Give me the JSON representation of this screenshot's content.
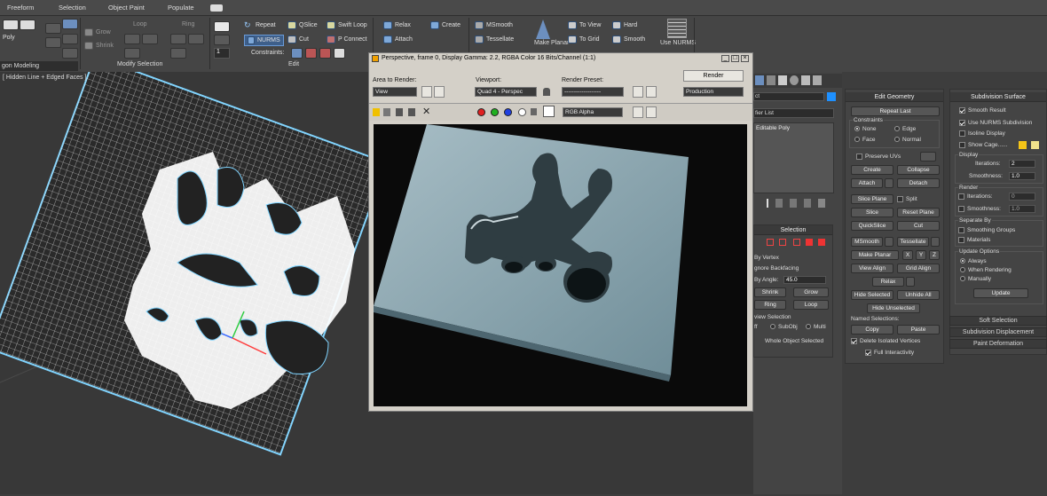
{
  "tabs": [
    "Freeform",
    "Selection",
    "Object Paint",
    "Populate"
  ],
  "ribbon": {
    "polygon_modeling": {
      "poly_label": "Poly",
      "panel_label": "gon Modeling"
    },
    "modify_selection": {
      "grow": "Grow",
      "shrink": "Shrink",
      "loop": "Loop",
      "ring": "Ring",
      "label": "Modify Selection"
    },
    "edit": {
      "repeat": "Repeat",
      "qslice": "QSlice",
      "swift_loop": "Swift Loop",
      "nurms": "NURMS",
      "cut": "Cut",
      "p_connect": "P Connect",
      "constraints": "Constraints:",
      "label": "Edit",
      "spinner_value": "1"
    },
    "geometry": {
      "relax": "Relax",
      "create": "Create",
      "attach": "Attach"
    },
    "subdivision": {
      "msmooth": "MSmooth",
      "tessellate": "Tessellate",
      "make_planar": "Make Planar",
      "to_view": "To View",
      "to_grid": "To Grid",
      "hard": "Hard",
      "smooth": "Smooth",
      "use_nurms": "Use NURMS"
    }
  },
  "viewport": {
    "label": "[ Hidden Line + Edged Faces ]"
  },
  "render_window": {
    "title": "Perspective, frame 0, Display Gamma: 2.2, RGBA Color 16 Bits/Channel (1:1)",
    "area_to_render_label": "Area to Render:",
    "area_to_render_value": "View",
    "viewport_label": "Viewport:",
    "viewport_value": "Quad 4 - Perspec",
    "render_preset_label": "Render Preset:",
    "render_preset_value": "-------------------",
    "render_button": "Render",
    "mode_value": "Production",
    "channel_value": "RGB Alpha"
  },
  "command_panel": {
    "modifier_list": "fier List",
    "stack_item": "Editable Poly",
    "object_label": "ct",
    "selection_title": "Selection",
    "by_vertex": "By Vertex",
    "ignore_backfacing": "gnore Backfacing",
    "by_angle": "By Angle:",
    "by_angle_value": "45.0",
    "shrink": "Shrink",
    "grow": "Grow",
    "ring": "Ring",
    "loop": "Loop",
    "preview_selection": "view Selection",
    "off": "ff",
    "subobj": "SubObj",
    "multi": "Multi",
    "whole_object_selected": "Whole Object Selected"
  },
  "edit_geometry": {
    "title": "Edit Geometry",
    "repeat_last": "Repeat Last",
    "constraints": "Constraints",
    "none": "None",
    "edge": "Edge",
    "face": "Face",
    "normal": "Normal",
    "preserve_uvs": "Preserve UVs",
    "create": "Create",
    "collapse": "Collapse",
    "attach": "Attach",
    "detach": "Detach",
    "slice_plane": "Slice Plane",
    "split": "Split",
    "slice": "Slice",
    "reset_plane": "Reset Plane",
    "quickslice": "QuickSlice",
    "cut": "Cut",
    "msmooth": "MSmooth",
    "tessellate": "Tessellate",
    "make_planar": "Make Planar",
    "x": "X",
    "y": "Y",
    "z": "Z",
    "view_align": "View Align",
    "grid_align": "Grid Align",
    "relax": "Relax",
    "hide_selected": "Hide Selected",
    "unhide_all": "Unhide All",
    "hide_unselected": "Hide Unselected",
    "named_selections": "Named Selections:",
    "copy": "Copy",
    "paste": "Paste",
    "delete_isolated": "Delete Isolated Vertices",
    "full_interactivity": "Full Interactivity"
  },
  "subdivision_surface": {
    "title": "Subdivision Surface",
    "smooth_result": "Smooth Result",
    "use_nurms": "Use NURMS Subdivision",
    "isoline_display": "Isoline Display",
    "show_cage": "Show Cage......",
    "display": "Display",
    "iterations": "Iterations:",
    "iterations_value": "2",
    "smoothness": "Smoothness:",
    "smoothness_value": "1.0",
    "render": "Render",
    "r_iterations": "Iterations:",
    "r_iterations_value": "0",
    "r_smoothness": "Smoothness:",
    "r_smoothness_value": "1.0",
    "separate_by": "Separate By",
    "smoothing_groups": "Smoothing Groups",
    "materials": "Materials",
    "update_options": "Update Options",
    "always": "Always",
    "when_rendering": "When Rendering",
    "manually": "Manually",
    "update": "Update",
    "soft_selection": "Soft Selection",
    "subdivision_displacement": "Subdivision Displacement",
    "paint_deformation": "Paint Deformation"
  },
  "colors": {
    "accent": "#1e90ff",
    "cage1": "#f5c518",
    "cage2": "#f0e28c",
    "bg": "#3d3d3d"
  }
}
